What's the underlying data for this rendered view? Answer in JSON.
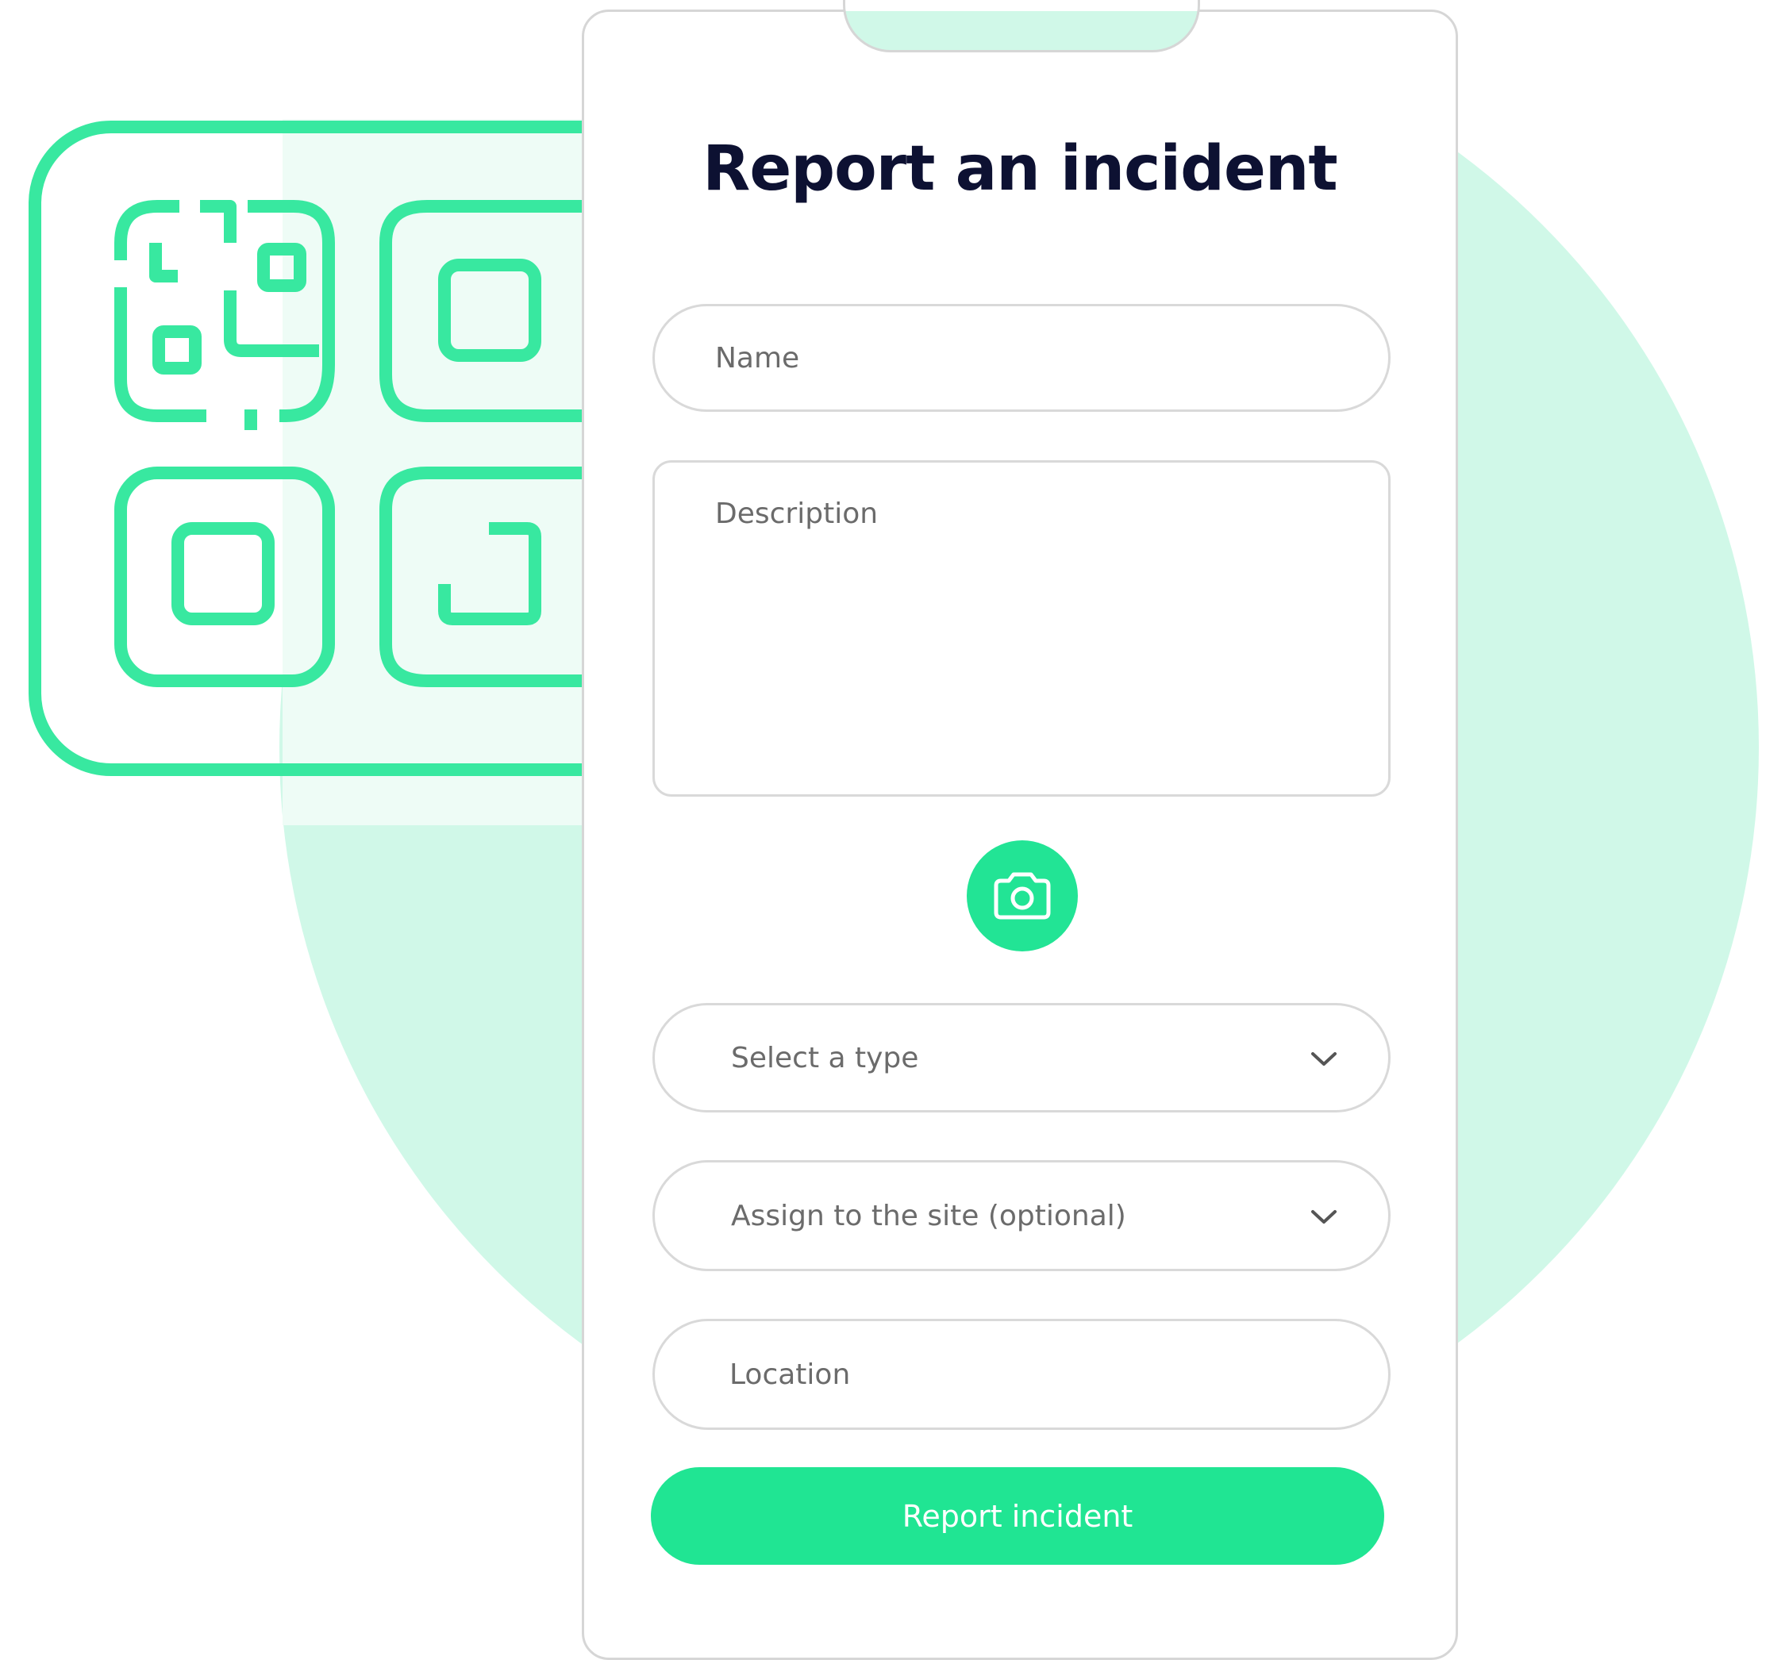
{
  "form": {
    "title": "Report an incident",
    "name_placeholder": "Name",
    "description_placeholder": "Description",
    "type_placeholder": "Select a type",
    "site_placeholder": "Assign to the site (optional)",
    "location_placeholder": "Location",
    "submit_label": "Report incident"
  },
  "icons": {
    "camera": "camera-icon",
    "dropdown": "chevron-down-icon",
    "illustration": "qr-code-icon"
  },
  "colors": {
    "accent": "#20e593",
    "accent_outline": "#38e8a0",
    "background_circle": "#d0f8e8",
    "title": "#0d1132",
    "placeholder": "#6b6b6b",
    "border": "#d9d9d9"
  }
}
